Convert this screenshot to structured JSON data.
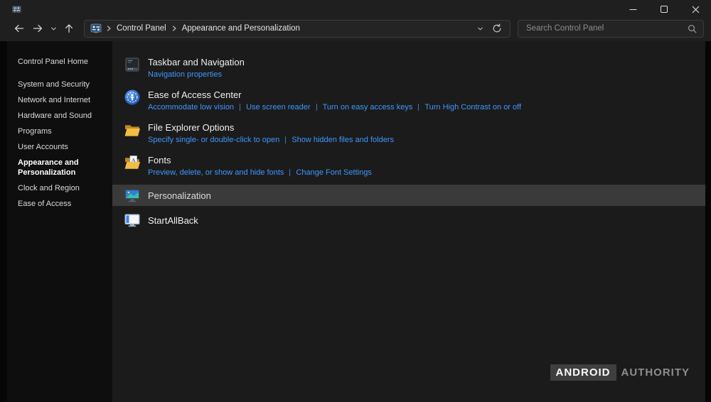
{
  "breadcrumb": {
    "items": [
      "Control Panel",
      "Appearance and Personalization"
    ]
  },
  "search": {
    "placeholder": "Search Control Panel"
  },
  "sidebar": {
    "items": [
      {
        "label": "Control Panel Home",
        "active": false
      },
      {
        "label": "System and Security",
        "active": false
      },
      {
        "label": "Network and Internet",
        "active": false
      },
      {
        "label": "Hardware and Sound",
        "active": false
      },
      {
        "label": "Programs",
        "active": false
      },
      {
        "label": "User Accounts",
        "active": false
      },
      {
        "label": "Appearance and Personalization",
        "active": true
      },
      {
        "label": "Clock and Region",
        "active": false
      },
      {
        "label": "Ease of Access",
        "active": false
      }
    ]
  },
  "main": {
    "categories": [
      {
        "title": "Taskbar and Navigation",
        "icon": "taskbar-icon",
        "links": [
          "Navigation properties"
        ]
      },
      {
        "title": "Ease of Access Center",
        "icon": "ease-of-access-icon",
        "links": [
          "Accommodate low vision",
          "Use screen reader",
          "Turn on easy access keys",
          "Turn High Contrast on or off"
        ]
      },
      {
        "title": "File Explorer Options",
        "icon": "folder-options-icon",
        "links": [
          "Specify single- or double-click to open",
          "Show hidden files and folders"
        ]
      },
      {
        "title": "Fonts",
        "icon": "fonts-folder-icon",
        "links": [
          "Preview, delete, or show and hide fonts",
          "Change Font Settings"
        ]
      },
      {
        "title": "Personalization",
        "icon": "personalization-icon",
        "links": [],
        "selected": true
      },
      {
        "title": "StartAllBack",
        "icon": "startallback-icon",
        "links": []
      }
    ]
  },
  "watermark": {
    "brand_badge": "ANDROID",
    "brand_text": "AUTHORITY"
  },
  "colors": {
    "link_blue": "#3f97ff",
    "selection_gray": "#3a3a3a",
    "titlebar": "#1f1f1f",
    "main_background": "#1b1b1b",
    "sidebar_background": "#0e0e0e"
  }
}
